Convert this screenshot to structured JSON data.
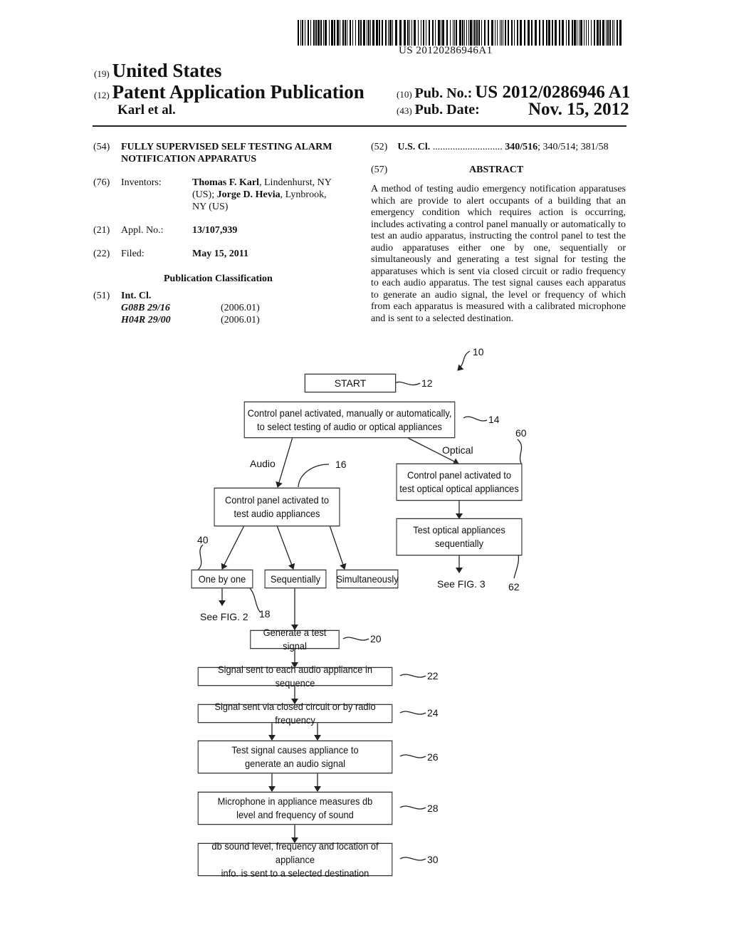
{
  "header": {
    "barcode_number": "US 20120286946A1",
    "country_code": "(19)",
    "country": "United States",
    "type_code": "(12)",
    "type": "Patent Application Publication",
    "authors": "Karl et al.",
    "pub_no_code": "(10)",
    "pub_no_label": "Pub. No.:",
    "pub_no": "US 2012/0286946 A1",
    "pub_date_code": "(43)",
    "pub_date_label": "Pub. Date:",
    "pub_date": "Nov. 15, 2012"
  },
  "biblio": {
    "title_code": "(54)",
    "title_line1": "FULLY SUPERVISED SELF TESTING ALARM",
    "title_line2": "NOTIFICATION APPARATUS",
    "inventors_code": "(76)",
    "inventors_label": "Inventors:",
    "inventor1_name": "Thomas F. Karl",
    "inventor1_loc": ", Lindenhurst, NY",
    "inventor2_pre": "(US); ",
    "inventor2_name": "Jorge D. Hevia",
    "inventor2_loc": ", Lynbrook,",
    "inventor2_loc2": "NY (US)",
    "appl_code": "(21)",
    "appl_label": "Appl. No.:",
    "appl_no": "13/107,939",
    "filed_code": "(22)",
    "filed_label": "Filed:",
    "filed_date": "May 15, 2011",
    "pub_class_heading": "Publication Classification",
    "intcl_code": "(51)",
    "intcl_label": "Int. Cl.",
    "intcl": [
      {
        "class": "G08B 29/16",
        "version": "(2006.01)"
      },
      {
        "class": "H04R 29/00",
        "version": "(2006.01)"
      }
    ],
    "uscl_code": "(52)",
    "uscl_label": "U.S. Cl.",
    "uscl_dots": "............................",
    "uscl_main": "340/516",
    "uscl_rest": "; 340/514; 381/58",
    "abstract_code": "(57)",
    "abstract_heading": "ABSTRACT",
    "abstract_text": "A method of testing audio emergency notification apparatuses which are provide to alert occupants of a building that an emergency condition which requires action is occurring, includes activating a control panel manually or automatically to test an audio apparatus, instructing the control panel to test the audio apparatuses either one by one, sequentially or simultaneously and generating a test signal for testing the apparatuses which is sent via closed circuit or radio frequency to each audio apparatus. The test signal causes each apparatus to generate an audio signal, the level or frequency of which from each apparatus is measured with a calibrated microphone and is sent to a selected destination."
  },
  "figure": {
    "ref_main": "10",
    "start": {
      "text": "START",
      "ref": "12"
    },
    "step14": {
      "line1": "Control panel activated, manually or automatically,",
      "line2": "to select testing of audio or optical appliances",
      "ref": "14"
    },
    "branch_audio": "Audio",
    "branch_optical": "Optical",
    "step16": {
      "line1": "Control panel activated to",
      "line2": "test audio appliances",
      "ref": "16"
    },
    "step60": {
      "line1": "Control panel activated to",
      "line2": "test optical optical appliances",
      "ref": "60"
    },
    "step62": {
      "line1": "Test optical appliances",
      "line2": "sequentially",
      "ref": "62"
    },
    "see_fig3": "See FIG. 3",
    "opt_one": {
      "text": "One by one",
      "ref": "40"
    },
    "opt_seq": "Sequentially",
    "opt_sim": "Simultaneously",
    "see_fig2": "See FIG. 2",
    "ref18": "18",
    "step20": {
      "text": "Generate a test signal",
      "ref": "20"
    },
    "step22": {
      "text": "Signal sent to each audio appliance in sequence",
      "ref": "22"
    },
    "step24": {
      "text": "Signal sent via closed circuit or by radio frequency",
      "ref": "24"
    },
    "step26": {
      "line1": "Test signal causes appliance to",
      "line2": "generate an audio signal",
      "ref": "26"
    },
    "step28": {
      "line1": "Microphone in appliance measures db",
      "line2": "level and frequency of sound",
      "ref": "28"
    },
    "step30": {
      "line1": "db sound level, frequency and location of appliance",
      "line2": "info. is sent to a selected destination",
      "ref": "30"
    }
  }
}
